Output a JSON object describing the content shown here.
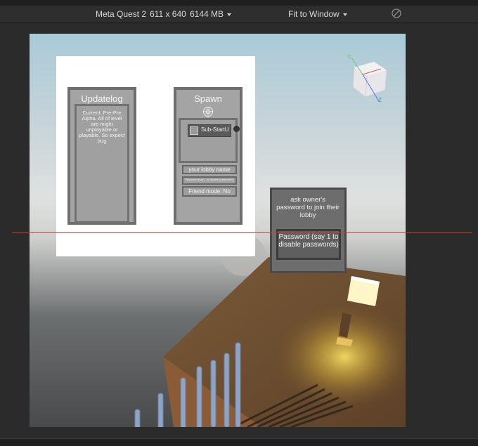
{
  "toolbar": {
    "device": "Meta Quest 2",
    "resolution": "611 x 640",
    "memory": "6144 MB",
    "fit_mode": "Fit to Window",
    "disable_icon": "no-entry-icon"
  },
  "updatelog": {
    "title": "Updatelog",
    "text": "Current: Pre-Pre Alpha. All of level are might unplayable or playable. So expect bug"
  },
  "spawn": {
    "title": "Spawn",
    "substart_label": "Sub-StartU",
    "lobby_name": "your lobby name",
    "password_hint": "Password (say 1 to disable passwords)",
    "friend_mode": "Friend mode: No"
  },
  "join_dialog": {
    "message": "ask owner's password to join their lobby",
    "password_placeholder": "Password (say 1 to disable passwords)"
  },
  "orientation_cube": {
    "axis_y": "Y",
    "axis_z": "Z"
  },
  "colors": {
    "guide_line": "#c33a3a",
    "lamp_glow": "#f5dd63"
  }
}
